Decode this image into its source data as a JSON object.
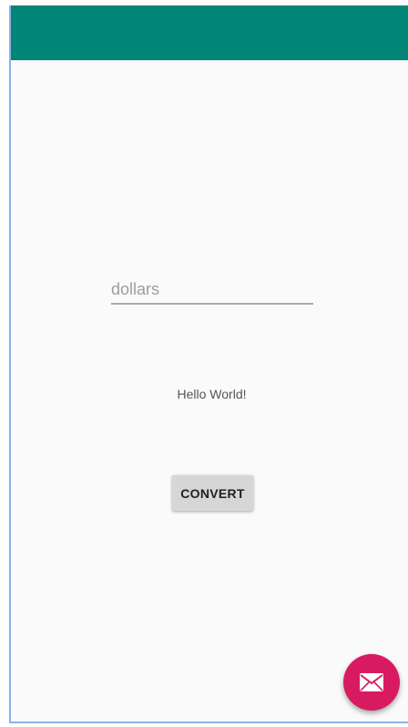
{
  "app_bar": {
    "color": "#008577"
  },
  "amount_input": {
    "placeholder": "dollars",
    "value": ""
  },
  "result": {
    "text": "Hello World!"
  },
  "convert_button": {
    "label": "CONVERT"
  },
  "fab": {
    "icon": "mail-icon",
    "color": "#d81b60"
  }
}
